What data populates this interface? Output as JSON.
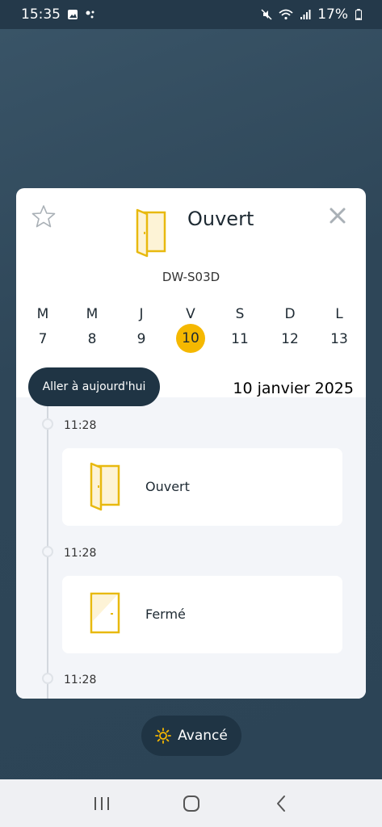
{
  "status_bar": {
    "time": "15:35",
    "battery": "17%",
    "icons": [
      "gallery-icon",
      "dots-icon",
      "mute-icon",
      "wifi-icon",
      "signal-icon",
      "battery-icon"
    ]
  },
  "card": {
    "title": "Ouvert",
    "device_name": "DW-S03D",
    "favorite_icon": "star-icon",
    "close_icon": "close-icon",
    "status_icon": "door-open-icon"
  },
  "week": [
    {
      "letter": "M",
      "num": "7"
    },
    {
      "letter": "M",
      "num": "8"
    },
    {
      "letter": "J",
      "num": "9"
    },
    {
      "letter": "V",
      "num": "10",
      "selected": true
    },
    {
      "letter": "S",
      "num": "11"
    },
    {
      "letter": "D",
      "num": "12"
    },
    {
      "letter": "L",
      "num": "13"
    }
  ],
  "today_button": "Aller à aujourd'hui",
  "current_date": "10 janvier 2025",
  "timeline": [
    {
      "time": "11:28",
      "label": "Ouvert",
      "icon": "door-open-icon"
    },
    {
      "time": "11:28",
      "label": "Fermé",
      "icon": "door-closed-icon"
    },
    {
      "time": "11:28"
    }
  ],
  "advanced_button": {
    "label": "Avancé",
    "icon": "sun-icon"
  },
  "nav_bar": [
    "recent-apps-icon",
    "home-icon",
    "back-icon"
  ],
  "colors": {
    "accent": "#f5b800",
    "dark": "#1f3444",
    "door": "#e8b90f"
  }
}
